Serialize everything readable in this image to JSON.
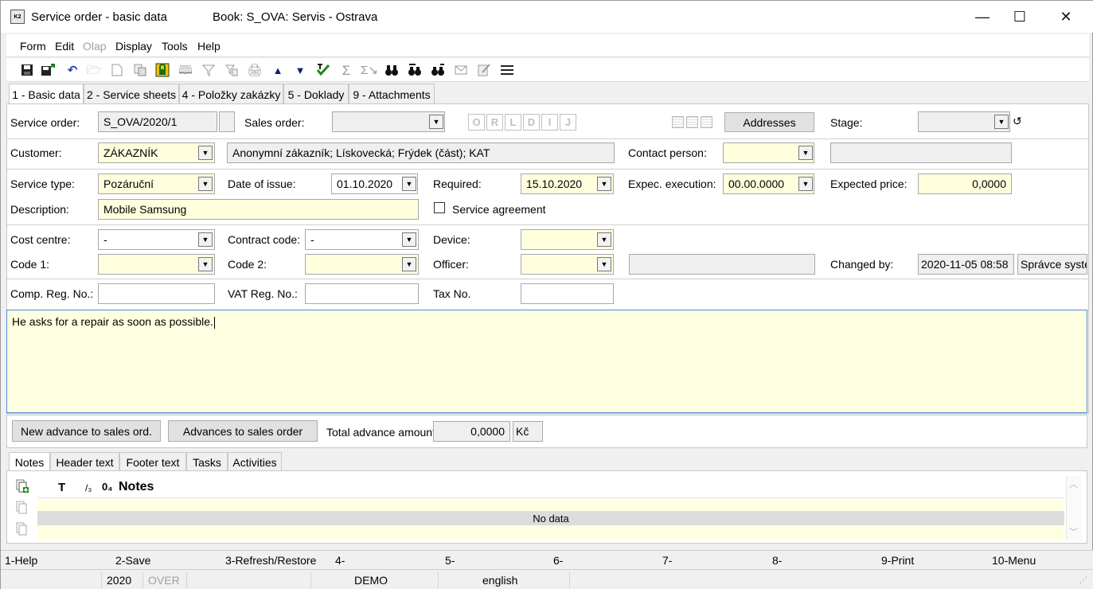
{
  "window": {
    "title": "Service order - basic data",
    "book": "Book: S_OVA: Servis - Ostrava",
    "minimize": "—",
    "maximize": "☐",
    "close": "✕"
  },
  "menu": [
    "Form",
    "Edit",
    "Olap",
    "Display",
    "Tools",
    "Help"
  ],
  "toolbar_icons": [
    "save-icon",
    "save-export-icon",
    "undo-icon",
    "open-folder-icon",
    "new-document-icon",
    "copy-icon",
    "lock-icon",
    "book-icon",
    "filter-icon",
    "filter-doc-icon",
    "print-icon",
    "arrow-up-icon",
    "arrow-down-icon",
    "select-icon",
    "sum-icon",
    "sum-arrow-icon",
    "binoculars-icon",
    "find-next-icon",
    "find-replace-icon",
    "mail-icon",
    "edit-icon",
    "menu-icon"
  ],
  "tabs": [
    "1 - Basic data",
    "2 - Service sheets",
    "4 - Položky zakázky",
    "5 - Doklady",
    "9 - Attachments"
  ],
  "form": {
    "service_order_label": "Service order:",
    "service_order": "S_OVA/2020/1",
    "sales_order_label": "Sales order:",
    "sales_order": "",
    "ordlij": [
      "O",
      "R",
      "L",
      "D",
      "I",
      "J"
    ],
    "addresses_button": "Addresses",
    "stage_label": "Stage:",
    "stage": "",
    "customer_label": "Customer:",
    "customer": "ZÁKAZNÍK",
    "customer_desc": "Anonymní zákazník; Lískovecká; Frýdek (část); KAT",
    "contact_person_label": "Contact person:",
    "contact_person": "",
    "contact_extra": "",
    "service_type_label": "Service type:",
    "service_type": "Pozáruční",
    "date_of_issue_label": "Date of issue:",
    "date_of_issue": "01.10.2020",
    "required_label": "Required:",
    "required": "15.10.2020",
    "expec_execution_label": "Expec. execution:",
    "expec_execution": "00.00.0000",
    "expected_price_label": "Expected price:",
    "expected_price": "0,0000",
    "description_label": "Description:",
    "description": "Mobile Samsung",
    "service_agreement_label": "Service agreement",
    "cost_centre_label": "Cost centre:",
    "cost_centre": "-",
    "contract_code_label": "Contract code:",
    "contract_code": "-",
    "device_label": "Device:",
    "device": "",
    "code1_label": "Code 1:",
    "code1": "",
    "code2_label": "Code 2:",
    "code2": "",
    "officer_label": "Officer:",
    "officer": "",
    "officer_name": "",
    "changed_by_label": "Changed by:",
    "changed_by_date": "2020-11-05 08:58",
    "changed_by_user": "Správce systé",
    "comp_reg_label": "Comp. Reg. No.:",
    "comp_reg": "",
    "vat_reg_label": "VAT Reg. No.:",
    "vat_reg": "",
    "tax_no_label": "Tax No.",
    "tax_no": ""
  },
  "notes_text": "He asks for a repair as soon as possible.",
  "advance": {
    "new_advance_button": "New advance to sales ord.",
    "advances_button": "Advances to sales order",
    "total_label": "Total advance amount:",
    "total_value": "0,0000",
    "currency": "Kč"
  },
  "bottom_tabs": [
    "Notes",
    "Header text",
    "Footer text",
    "Tasks",
    "Activities"
  ],
  "grid": {
    "col_t": "T",
    "col_slash": "/₃",
    "col_zero": "0₄",
    "col_notes": "Notes",
    "empty": "No data"
  },
  "fkeys": [
    "1-Help",
    "2-Save",
    "3-Refresh/Restore",
    "4-",
    "5-",
    "6-",
    "7-",
    "8-",
    "9-Print",
    "10-Menu"
  ],
  "status": {
    "year": "2020",
    "mode": "OVER",
    "db": "DEMO",
    "lang": "english"
  }
}
